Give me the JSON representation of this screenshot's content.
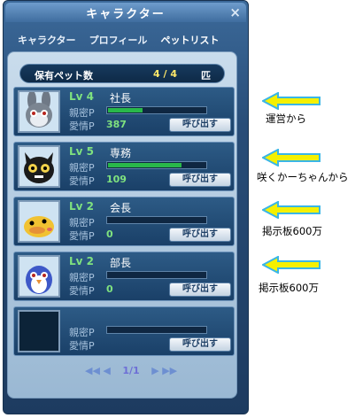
{
  "window": {
    "title": "キャラクター",
    "close_symbol": "×"
  },
  "tabs": [
    {
      "label": "キャラクター"
    },
    {
      "label": "プロフィール"
    },
    {
      "label": "ペットリスト"
    }
  ],
  "pet_count": {
    "label": "保有ペット数",
    "value": "4 / 4",
    "unit": "匹"
  },
  "pets": [
    {
      "level": "Lv 4",
      "role": "社長",
      "intimacy_label": "親密P",
      "affection_label": "愛情P",
      "affection_value": "387",
      "intimacy_fraction": 0.35,
      "button": "呼び出す",
      "portrait": "rabbit-pet"
    },
    {
      "level": "Lv 5",
      "role": "専務",
      "intimacy_label": "親密P",
      "affection_label": "愛情P",
      "affection_value": "109",
      "intimacy_fraction": 0.75,
      "button": "呼び出す",
      "portrait": "black-cat-pet"
    },
    {
      "level": "Lv 2",
      "role": "会長",
      "intimacy_label": "親密P",
      "affection_label": "愛情P",
      "affection_value": "0",
      "intimacy_fraction": 0.0,
      "button": "呼び出す",
      "portrait": "yellow-chick-pet"
    },
    {
      "level": "Lv 2",
      "role": "部長",
      "intimacy_label": "親密P",
      "affection_label": "愛情P",
      "affection_value": "0",
      "intimacy_fraction": 0.0,
      "button": "呼び出す",
      "portrait": "penguin-pet"
    },
    {
      "level": "",
      "role": "",
      "intimacy_label": "親密P",
      "affection_label": "愛情P",
      "affection_value": "",
      "intimacy_fraction": 0.0,
      "button": "呼び出す",
      "portrait": "empty"
    }
  ],
  "pager": {
    "first": "◀◀",
    "prev": "◀",
    "page": "1/1",
    "next": "▶",
    "last": "▶▶"
  },
  "annotations": [
    {
      "text": "運営から"
    },
    {
      "text": "咲くかーちゃんから"
    },
    {
      "text": "掲示板600万"
    },
    {
      "text": "掲示板600万"
    }
  ],
  "colors": {
    "level_text": "#7fe27f",
    "bar_fill": "#29b84a",
    "arrow_fill": "#f5f000",
    "arrow_outline": "#3ab6e6"
  }
}
